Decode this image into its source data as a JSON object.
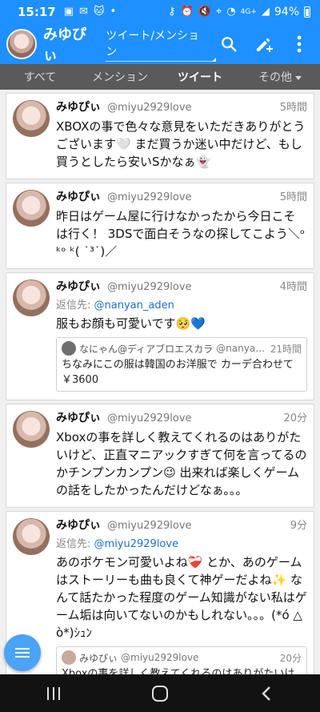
{
  "status": {
    "time": "15:17",
    "battery": "94%",
    "network": "4G+"
  },
  "appbar": {
    "title": "みゆぴぃ",
    "subtitle": "ツイート/メンション"
  },
  "tabs": [
    "すべて",
    "メンション",
    "ツイート",
    "その他"
  ],
  "tweets": [
    {
      "name": "みゆぴぃ",
      "handle": "@miyu2929love",
      "time": "5時間",
      "text": "XBOXの事で色々な意見をいただきありがとうございます🤍 まだ買うか迷い中だけど、もし買うとしたら安いSかなぁ👻"
    },
    {
      "name": "みゆぴぃ",
      "handle": "@miyu2929love",
      "time": "5時間",
      "text": "昨日はゲーム屋に行けなかったから今日こそは行く！ 3DSで面白そうなの探してこよう＼ᵒᵏᵒ ᵏ( ˙³˙)／"
    },
    {
      "name": "みゆぴぃ",
      "handle": "@miyu2929love",
      "time": "4時間",
      "reply_label": "返信先:",
      "reply_to": "@nanyan_aden",
      "text": "服もお顔も可愛いです🥺💙",
      "quote": {
        "name": "なにゃん@ディアブロエスカラ",
        "handle": "@nanyan...",
        "time": "21時間",
        "text": "ちなみにこの服は韓国のお洋服で カーデ合わせて￥3600"
      }
    },
    {
      "name": "みゆぴぃ",
      "handle": "@miyu2929love",
      "time": "20分",
      "text": "Xboxの事を詳しく教えてくれるのはありがたいけど、正直マニアックすぎて何を言ってるのかチンプンカンプン😉 出来れば楽しくゲームの話をしたかったんだけどなぁ。。。"
    },
    {
      "name": "みゆぴぃ",
      "handle": "@miyu2929love",
      "time": "9分",
      "reply_label": "返信先:",
      "reply_to": "@miyu2929love",
      "text": "あのポケモン可愛いよね❤️‍🩹 とか、あのゲームはストーリーも曲も良くて神ゲーだよね✨ なんて話たかった程度のゲーム知識がない私はゲーム垢は向いてないのかもしれない。。。(*ó △ ò*)ｼｭﾝ",
      "quote": {
        "name": "みゆぴぃ",
        "handle": "@miyu2929love",
        "time": "20分",
        "text": "Xboxの事を詳しく教えてくれるのはありがたいけど、正直マニアックすぎて何を言ってるのかチンプンカンプン😉 出来れば楽しくゲームの話をしたかっ..."
      }
    }
  ],
  "icons": {
    "search": "search-icon",
    "compose": "compose-icon",
    "menu": "more-vert-icon",
    "fab": "menu-icon"
  },
  "colors": {
    "accent": "#1e90ff",
    "tabbar": "#5a5a5a",
    "link": "#1a6fd0"
  }
}
